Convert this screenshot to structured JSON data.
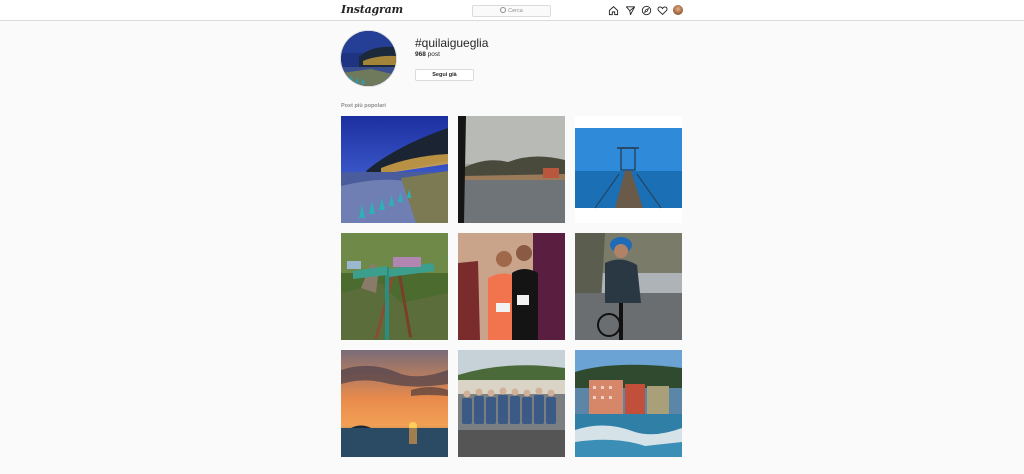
{
  "header": {
    "logo": "Instagram",
    "search_placeholder": "Cerca",
    "icons": [
      "home-icon",
      "direct-icon",
      "explore-icon",
      "heart-icon",
      "avatar"
    ]
  },
  "profile": {
    "hashtag": "#quilaigueglia",
    "post_count": "968",
    "post_label": "post",
    "follow_button": "Segui già"
  },
  "main": {
    "section_title": "Post più popolari"
  },
  "posts": [
    {
      "subject": "Alassio bay at night with lights"
    },
    {
      "subject": "Coastal town at dusk with sea"
    },
    {
      "subject": "Wooden pier over blue sea"
    },
    {
      "subject": "Wooden trail signpost in forest"
    },
    {
      "subject": "Couple of runners with race bibs"
    },
    {
      "subject": "Cyclist in blue helmet on road"
    },
    {
      "subject": "Sunset over the sea"
    },
    {
      "subject": "Cycling team group photo"
    },
    {
      "subject": "Colorful seaside buildings and waves"
    }
  ],
  "colors": {
    "background": "#fafafa",
    "border": "#dbdbdb",
    "text": "#262626",
    "muted": "#8e8e8e"
  }
}
